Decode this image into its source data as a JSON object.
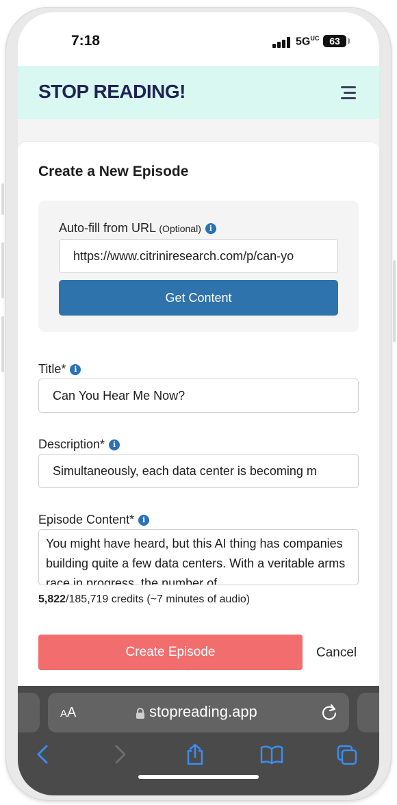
{
  "status_bar": {
    "time": "7:18",
    "network": "5G",
    "network_suffix": "UC",
    "battery": "63"
  },
  "header": {
    "brand": "STOP READING!",
    "menu_icon": "hamburger-icon"
  },
  "form": {
    "title": "Create a New Episode",
    "url_section": {
      "label": "Auto-fill from URL",
      "optional": "(Optional)",
      "value": "https://www.citriniresearch.com/p/can-yo",
      "button": "Get Content"
    },
    "title_field": {
      "label": "Title",
      "required": "*",
      "value": "Can You Hear Me Now?"
    },
    "description_field": {
      "label": "Description",
      "required": "*",
      "value": "Simultaneously, each data center is becoming m"
    },
    "content_field": {
      "label": "Episode Content",
      "required": "*",
      "value": "You might have heard, but this AI thing has companies building quite a few data centers. With a veritable arms race in progress, the number of"
    },
    "credits": {
      "used": "5,822",
      "rest": "/185,719 credits (~7 minutes of audio)"
    },
    "create_button": "Create Episode",
    "cancel": "Cancel"
  },
  "browser": {
    "text_size": "AA",
    "domain": "stopreading.app"
  },
  "colors": {
    "header_bg": "#d9f8f1",
    "brand": "#1f2454",
    "primary_button": "#2f73ad",
    "create_button": "#f26e6e",
    "info_icon": "#2a72b5",
    "browser_bar": "#4a4a4a"
  }
}
